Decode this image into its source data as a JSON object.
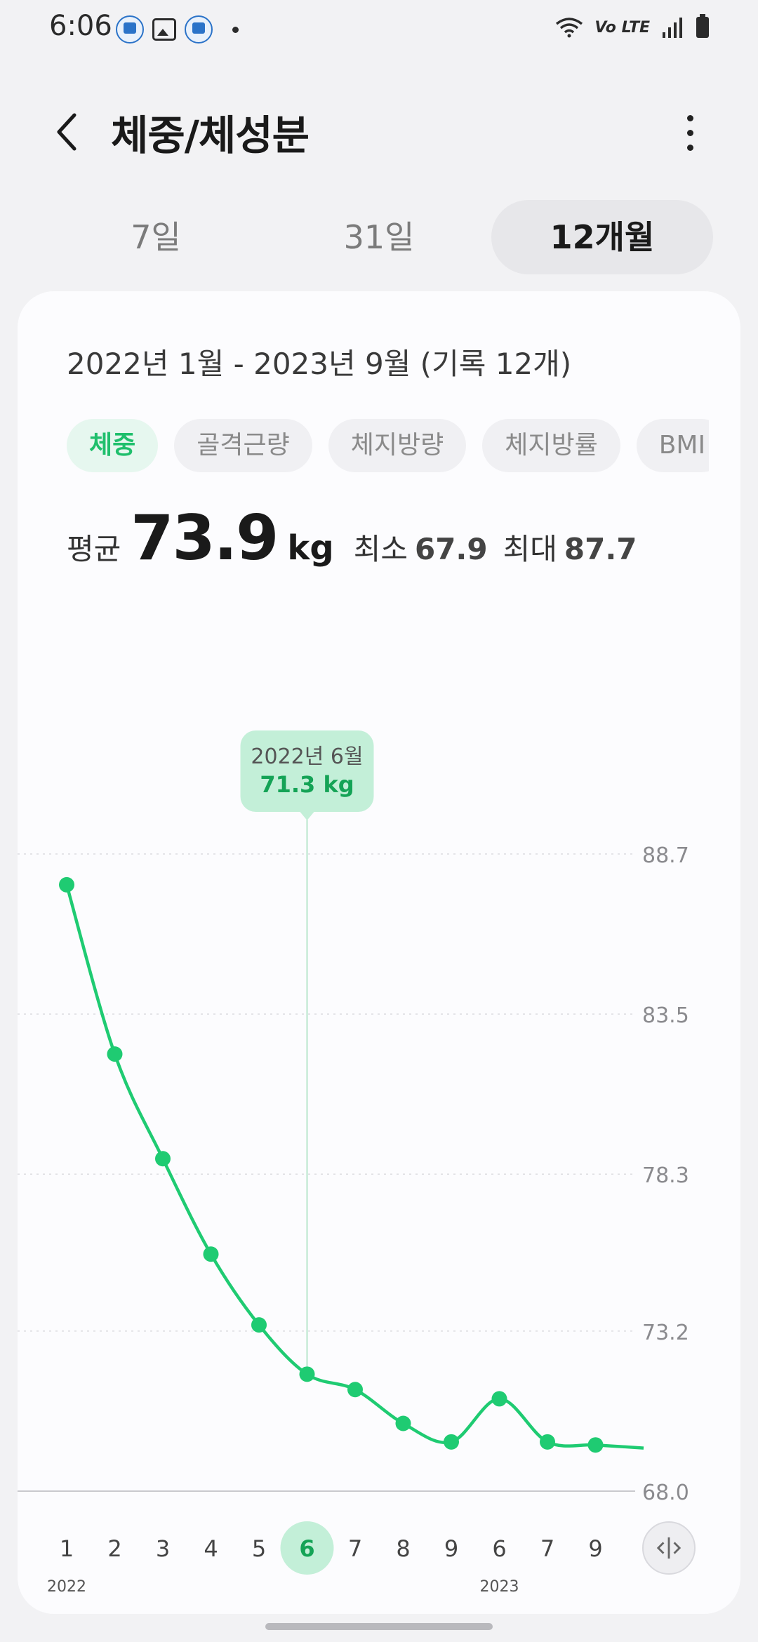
{
  "status_bar": {
    "time": "6:06",
    "left_icons": [
      "app-icon",
      "gallery-icon",
      "app-icon",
      "notification-dot-icon"
    ],
    "right_icons": [
      "wifi-icon",
      "volte-icon",
      "signal-icon",
      "battery-icon"
    ],
    "volte_text": "Vo LTE"
  },
  "header": {
    "title": "체중/체성분",
    "back_icon": "chevron-left-icon",
    "more_icon": "more-vertical-icon"
  },
  "tabs": [
    {
      "label": "7일",
      "active": false
    },
    {
      "label": "31일",
      "active": false
    },
    {
      "label": "12개월",
      "active": true
    }
  ],
  "card": {
    "range_label": "2022년 1월 - 2023년 9월 (기록 12개)",
    "chips": [
      {
        "label": "체중",
        "active": true
      },
      {
        "label": "골격근량",
        "active": false
      },
      {
        "label": "체지방량",
        "active": false
      },
      {
        "label": "체지방률",
        "active": false
      },
      {
        "label": "BMI",
        "active": false
      }
    ],
    "stats": {
      "avg_label": "평균",
      "avg_value": "73.9",
      "avg_unit": "kg",
      "min_label": "최소",
      "min_value": "67.9",
      "max_label": "최대",
      "max_value": "87.7"
    }
  },
  "chart_data": {
    "type": "line",
    "series": [
      {
        "values": [
          87.7,
          82.2,
          78.8,
          75.7,
          73.4,
          71.8,
          71.3,
          70.2,
          69.6,
          71.0,
          69.6,
          69.5,
          69.4
        ]
      }
    ],
    "x": [
      "1",
      "2",
      "3",
      "4",
      "5",
      "6",
      "7",
      "8",
      "9",
      "6",
      "7",
      "9",
      ""
    ],
    "x_year_labels": [
      {
        "index": 0,
        "label": "2022"
      },
      {
        "index": 9,
        "label": "2023"
      }
    ],
    "y_ticks": [
      "88.7",
      "83.5",
      "78.3",
      "73.2",
      "68.0"
    ],
    "ylim": [
      68.0,
      88.7
    ],
    "selected_index": 5,
    "tooltip": {
      "date": "2022년 6월",
      "value": "71.3 kg"
    },
    "line_color": "#1fcb72",
    "tooltip_color": "#c3efd8",
    "grid": true
  },
  "scroll_icon": "expand-horizontal-icon"
}
